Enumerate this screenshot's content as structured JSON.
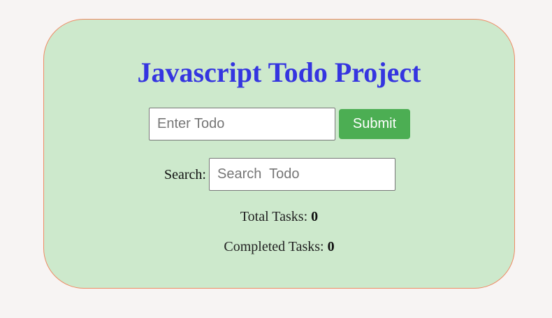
{
  "app": {
    "title": "Javascript Todo Project"
  },
  "todo_form": {
    "input_value": "",
    "input_placeholder": "Enter Todo",
    "submit_label": "Submit"
  },
  "search": {
    "label": "Search:",
    "input_value": "",
    "input_placeholder": "Search  Todo"
  },
  "stats": {
    "total_label": "Total Tasks:",
    "total_value": "0",
    "completed_label": "Completed Tasks:",
    "completed_value": "0"
  },
  "colors": {
    "card_background": "#cde9cc",
    "card_border": "#ef8a64",
    "title": "#3535e0",
    "submit_button": "#4cae53",
    "page_background": "#f7f4f3"
  }
}
